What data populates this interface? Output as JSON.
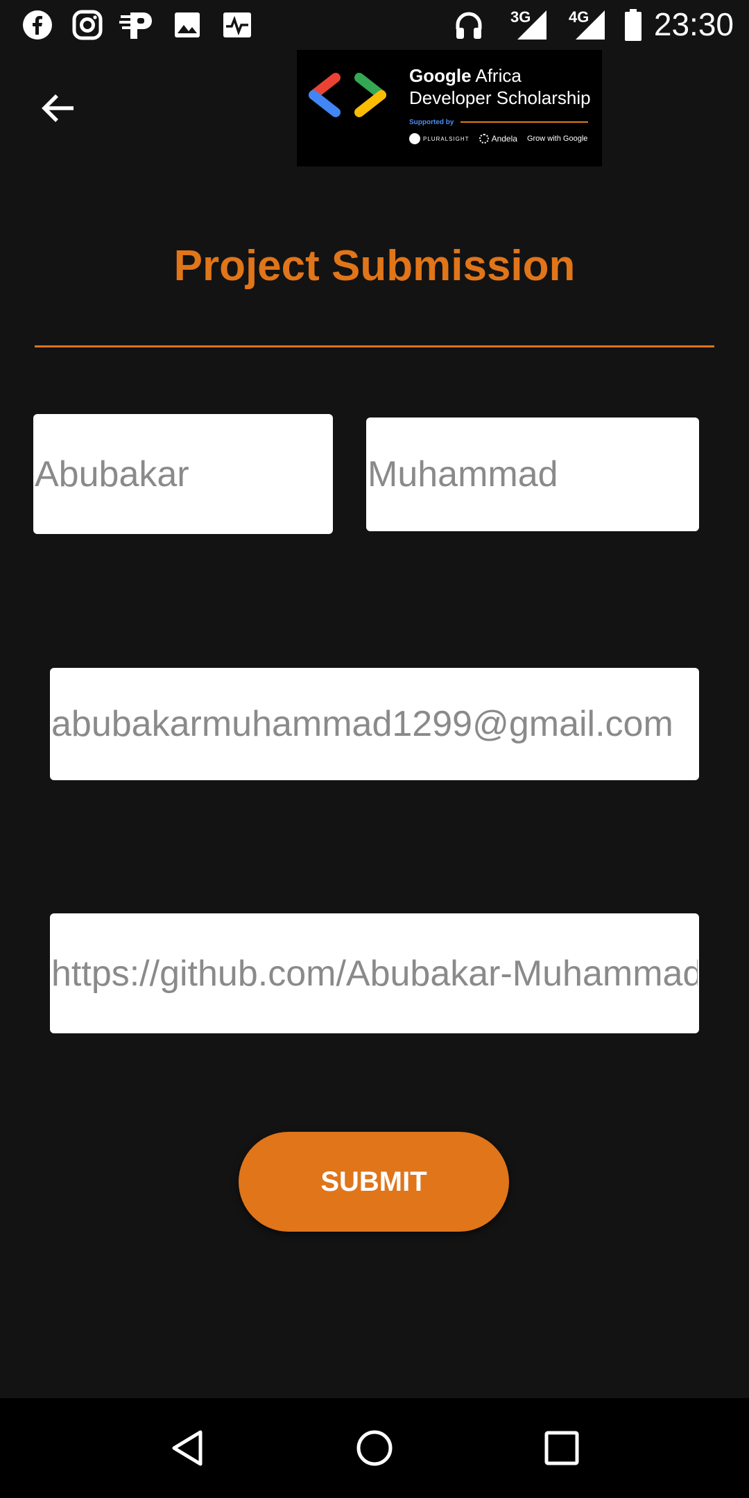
{
  "status_bar": {
    "time": "23:30",
    "network_1": "3G",
    "network_2": "4G",
    "icons": [
      "facebook-icon",
      "instagram-icon",
      "paystack-icon",
      "image-icon",
      "pulse-icon",
      "headphones-icon",
      "signal-icon",
      "battery-icon"
    ]
  },
  "app_bar": {
    "back_icon": "arrow-left-icon",
    "logo": {
      "line1_bold": "Google",
      "line1_rest": " Africa",
      "line2": "Developer Scholarship",
      "supported_by": "Supported by",
      "partners": [
        "PLURALSIGHT",
        "Andela",
        "Grow with Google"
      ]
    }
  },
  "page": {
    "title": "Project Submission"
  },
  "form": {
    "first_name": {
      "value": "",
      "placeholder": "Abubakar"
    },
    "last_name": {
      "value": "",
      "placeholder": "Muhammad"
    },
    "email": {
      "value": "",
      "placeholder": "abubakarmuhammad1299@gmail.com"
    },
    "project_link": {
      "value": "",
      "placeholder": "https://github.com/Abubakar-Muhammad"
    },
    "submit_label": "SUBMIT"
  },
  "colors": {
    "accent": "#e0751a",
    "background": "#131313"
  },
  "nav_bar": {
    "icons": [
      "back-triangle-icon",
      "home-circle-icon",
      "recents-square-icon"
    ]
  }
}
